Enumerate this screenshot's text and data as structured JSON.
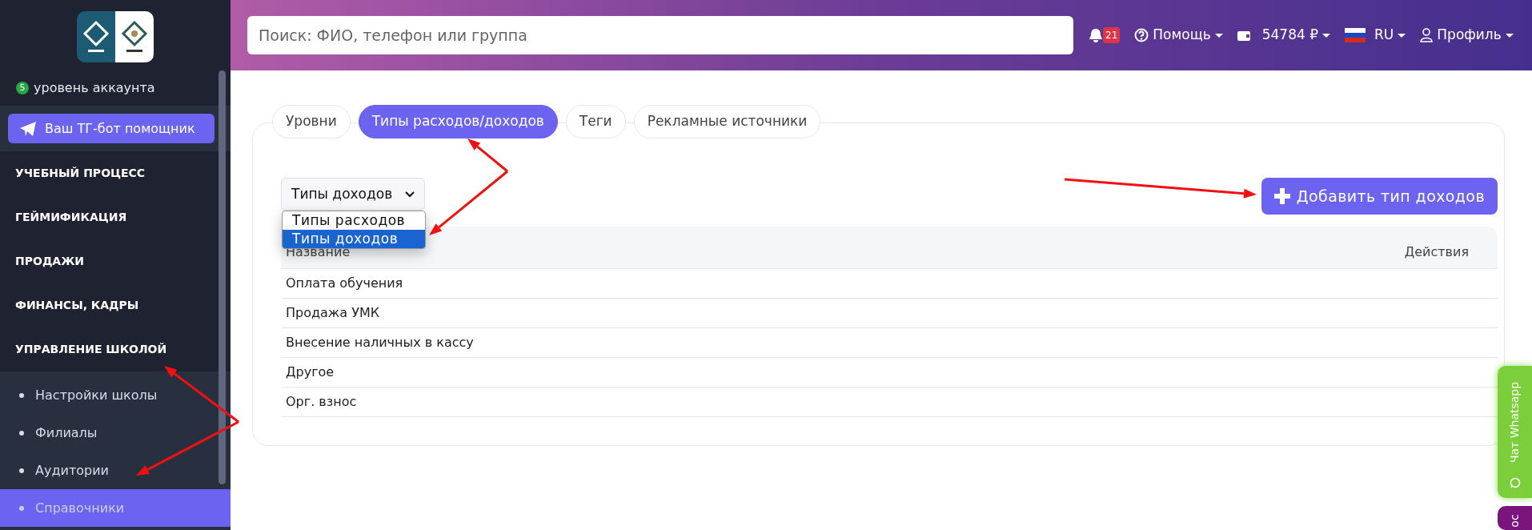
{
  "sidebar": {
    "account_level": {
      "badge": "5",
      "label": "уровень аккаунта"
    },
    "bot_button": "Ваш ТГ-бот помощник",
    "menu": [
      {
        "label": "УЧЕБНЫЙ ПРОЦЕСС"
      },
      {
        "label": "ГЕЙМИФИКАЦИЯ"
      },
      {
        "label": "ПРОДАЖИ"
      },
      {
        "label": "ФИНАНСЫ, КАДРЫ"
      },
      {
        "label": "УПРАВЛЕНИЕ ШКОЛОЙ",
        "children": [
          {
            "label": "Настройки школы",
            "selected": false
          },
          {
            "label": "Филиалы",
            "selected": false
          },
          {
            "label": "Аудитории",
            "selected": false
          },
          {
            "label": "Справочники",
            "selected": true
          }
        ]
      }
    ]
  },
  "header": {
    "search": {
      "placeholder": "Поиск: ФИО, телефон или группа"
    },
    "notifications": "21",
    "help": "Помощь",
    "balance": "54784 ₽",
    "language": "RU",
    "profile": "Профиль"
  },
  "tabs": [
    {
      "label": "Уровни",
      "selected": false
    },
    {
      "label": "Типы расходов/доходов",
      "selected": true
    },
    {
      "label": "Теги",
      "selected": false
    },
    {
      "label": "Рекламные источники",
      "selected": false
    }
  ],
  "type_select": {
    "value": "Типы доходов",
    "expanded": true,
    "options": [
      {
        "label": "Типы расходов",
        "selected": false
      },
      {
        "label": "Типы доходов",
        "selected": true
      }
    ]
  },
  "add_button": "Добавить тип доходов",
  "table": {
    "columns": [
      "Название",
      "Действия"
    ],
    "rows": [
      {
        "name": "Оплата обучения"
      },
      {
        "name": "Продажа УМК"
      },
      {
        "name": "Внесение наличных в кассу"
      },
      {
        "name": "Другое"
      },
      {
        "name": "Орг. взнос"
      }
    ]
  },
  "side_tabs": [
    {
      "label": "Чат Whatsapp",
      "color": "#7ccf3a"
    },
    {
      "label": "ос",
      "color": "#7b157e"
    }
  ]
}
